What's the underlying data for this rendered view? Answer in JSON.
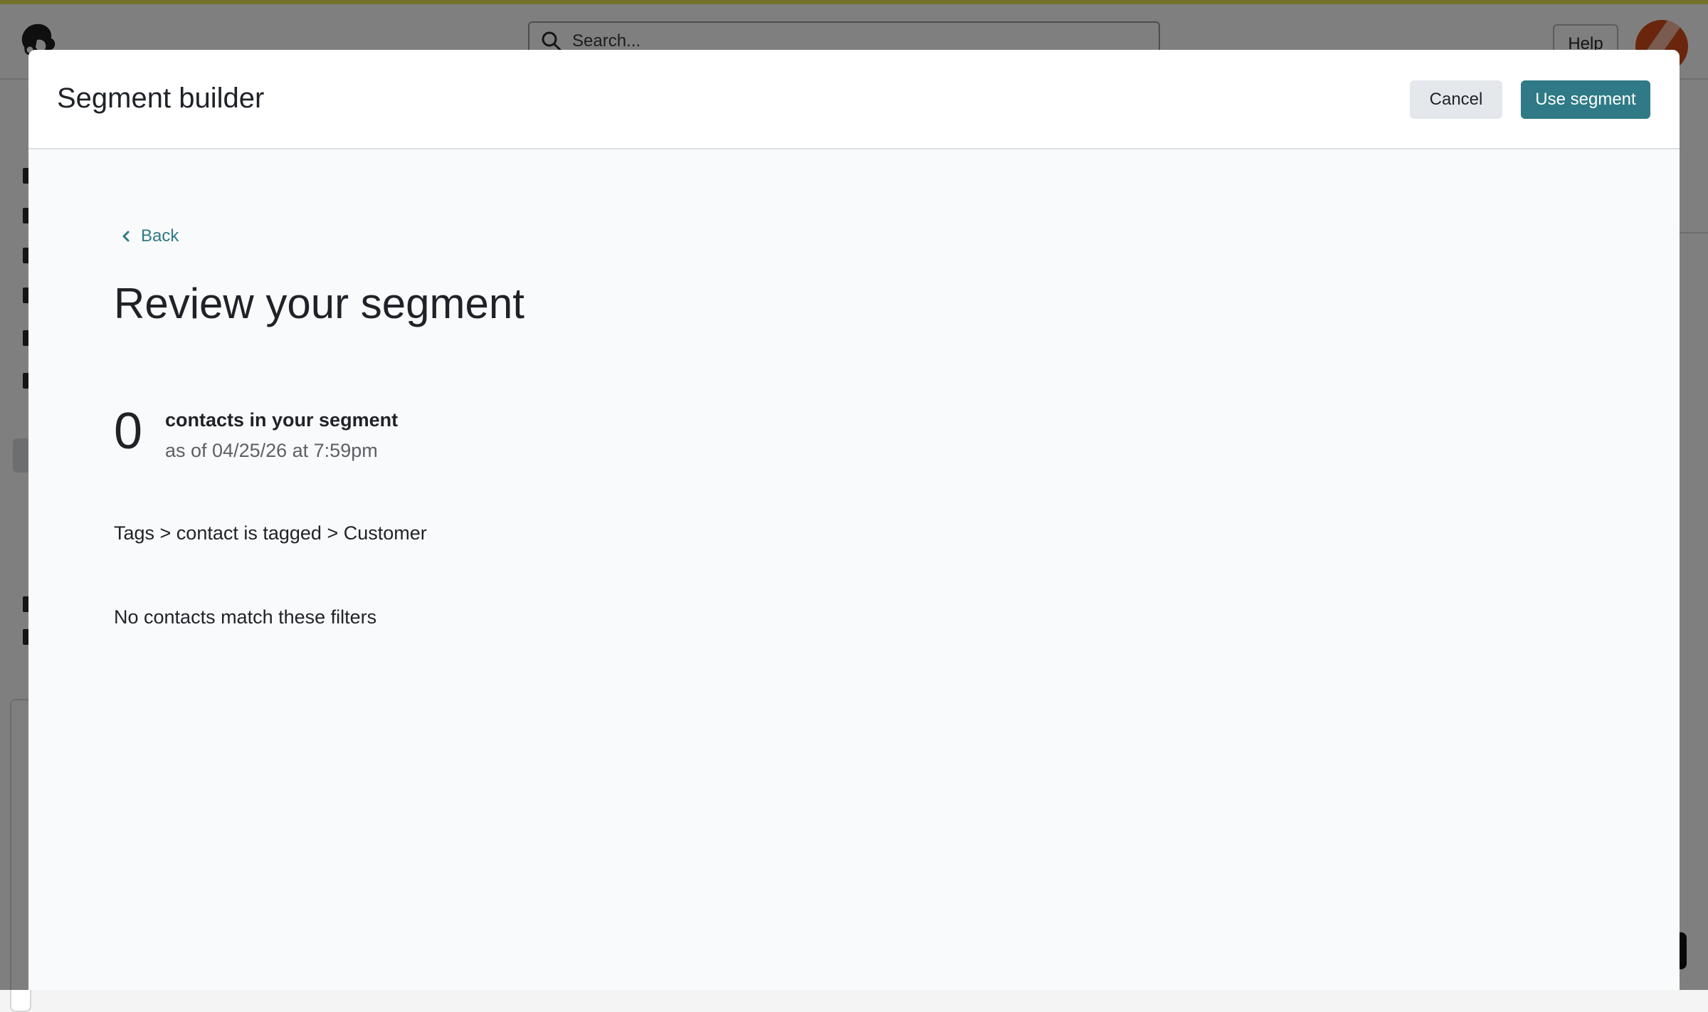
{
  "app": {
    "search_placeholder": "Search...",
    "help_label": "Help"
  },
  "modal": {
    "title": "Segment builder",
    "cancel_label": "Cancel",
    "use_segment_label": "Use segment",
    "back_label": "Back",
    "heading": "Review your segment",
    "contact_count": "0",
    "count_label": "contacts in your segment",
    "as_of": "as of 04/25/26 at 7:59pm",
    "filter_summary": "Tags > contact is tagged > Customer",
    "empty_message": "No contacts match these filters"
  },
  "colors": {
    "accent": "#2f7a86",
    "top_strip": "#e9e35a",
    "avatar": "#d24c1a"
  }
}
